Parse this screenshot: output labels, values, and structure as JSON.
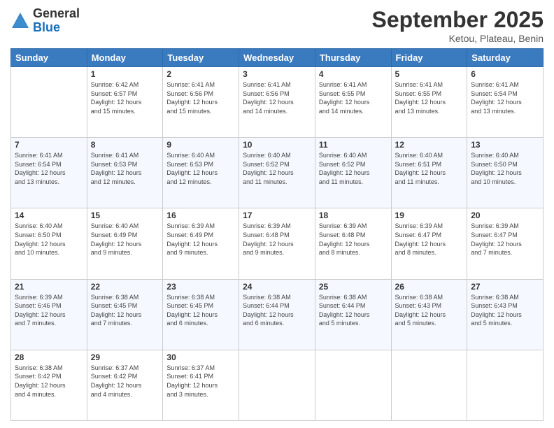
{
  "header": {
    "logo": {
      "general": "General",
      "blue": "Blue"
    },
    "title": "September 2025",
    "location": "Ketou, Plateau, Benin"
  },
  "days_of_week": [
    "Sunday",
    "Monday",
    "Tuesday",
    "Wednesday",
    "Thursday",
    "Friday",
    "Saturday"
  ],
  "weeks": [
    [
      {
        "day": "",
        "info": ""
      },
      {
        "day": "1",
        "info": "Sunrise: 6:42 AM\nSunset: 6:57 PM\nDaylight: 12 hours\nand 15 minutes."
      },
      {
        "day": "2",
        "info": "Sunrise: 6:41 AM\nSunset: 6:56 PM\nDaylight: 12 hours\nand 15 minutes."
      },
      {
        "day": "3",
        "info": "Sunrise: 6:41 AM\nSunset: 6:56 PM\nDaylight: 12 hours\nand 14 minutes."
      },
      {
        "day": "4",
        "info": "Sunrise: 6:41 AM\nSunset: 6:55 PM\nDaylight: 12 hours\nand 14 minutes."
      },
      {
        "day": "5",
        "info": "Sunrise: 6:41 AM\nSunset: 6:55 PM\nDaylight: 12 hours\nand 13 minutes."
      },
      {
        "day": "6",
        "info": "Sunrise: 6:41 AM\nSunset: 6:54 PM\nDaylight: 12 hours\nand 13 minutes."
      }
    ],
    [
      {
        "day": "7",
        "info": "Sunrise: 6:41 AM\nSunset: 6:54 PM\nDaylight: 12 hours\nand 13 minutes."
      },
      {
        "day": "8",
        "info": "Sunrise: 6:41 AM\nSunset: 6:53 PM\nDaylight: 12 hours\nand 12 minutes."
      },
      {
        "day": "9",
        "info": "Sunrise: 6:40 AM\nSunset: 6:53 PM\nDaylight: 12 hours\nand 12 minutes."
      },
      {
        "day": "10",
        "info": "Sunrise: 6:40 AM\nSunset: 6:52 PM\nDaylight: 12 hours\nand 11 minutes."
      },
      {
        "day": "11",
        "info": "Sunrise: 6:40 AM\nSunset: 6:52 PM\nDaylight: 12 hours\nand 11 minutes."
      },
      {
        "day": "12",
        "info": "Sunrise: 6:40 AM\nSunset: 6:51 PM\nDaylight: 12 hours\nand 11 minutes."
      },
      {
        "day": "13",
        "info": "Sunrise: 6:40 AM\nSunset: 6:50 PM\nDaylight: 12 hours\nand 10 minutes."
      }
    ],
    [
      {
        "day": "14",
        "info": "Sunrise: 6:40 AM\nSunset: 6:50 PM\nDaylight: 12 hours\nand 10 minutes."
      },
      {
        "day": "15",
        "info": "Sunrise: 6:40 AM\nSunset: 6:49 PM\nDaylight: 12 hours\nand 9 minutes."
      },
      {
        "day": "16",
        "info": "Sunrise: 6:39 AM\nSunset: 6:49 PM\nDaylight: 12 hours\nand 9 minutes."
      },
      {
        "day": "17",
        "info": "Sunrise: 6:39 AM\nSunset: 6:48 PM\nDaylight: 12 hours\nand 9 minutes."
      },
      {
        "day": "18",
        "info": "Sunrise: 6:39 AM\nSunset: 6:48 PM\nDaylight: 12 hours\nand 8 minutes."
      },
      {
        "day": "19",
        "info": "Sunrise: 6:39 AM\nSunset: 6:47 PM\nDaylight: 12 hours\nand 8 minutes."
      },
      {
        "day": "20",
        "info": "Sunrise: 6:39 AM\nSunset: 6:47 PM\nDaylight: 12 hours\nand 7 minutes."
      }
    ],
    [
      {
        "day": "21",
        "info": "Sunrise: 6:39 AM\nSunset: 6:46 PM\nDaylight: 12 hours\nand 7 minutes."
      },
      {
        "day": "22",
        "info": "Sunrise: 6:38 AM\nSunset: 6:45 PM\nDaylight: 12 hours\nand 7 minutes."
      },
      {
        "day": "23",
        "info": "Sunrise: 6:38 AM\nSunset: 6:45 PM\nDaylight: 12 hours\nand 6 minutes."
      },
      {
        "day": "24",
        "info": "Sunrise: 6:38 AM\nSunset: 6:44 PM\nDaylight: 12 hours\nand 6 minutes."
      },
      {
        "day": "25",
        "info": "Sunrise: 6:38 AM\nSunset: 6:44 PM\nDaylight: 12 hours\nand 5 minutes."
      },
      {
        "day": "26",
        "info": "Sunrise: 6:38 AM\nSunset: 6:43 PM\nDaylight: 12 hours\nand 5 minutes."
      },
      {
        "day": "27",
        "info": "Sunrise: 6:38 AM\nSunset: 6:43 PM\nDaylight: 12 hours\nand 5 minutes."
      }
    ],
    [
      {
        "day": "28",
        "info": "Sunrise: 6:38 AM\nSunset: 6:42 PM\nDaylight: 12 hours\nand 4 minutes."
      },
      {
        "day": "29",
        "info": "Sunrise: 6:37 AM\nSunset: 6:42 PM\nDaylight: 12 hours\nand 4 minutes."
      },
      {
        "day": "30",
        "info": "Sunrise: 6:37 AM\nSunset: 6:41 PM\nDaylight: 12 hours\nand 3 minutes."
      },
      {
        "day": "",
        "info": ""
      },
      {
        "day": "",
        "info": ""
      },
      {
        "day": "",
        "info": ""
      },
      {
        "day": "",
        "info": ""
      }
    ]
  ]
}
